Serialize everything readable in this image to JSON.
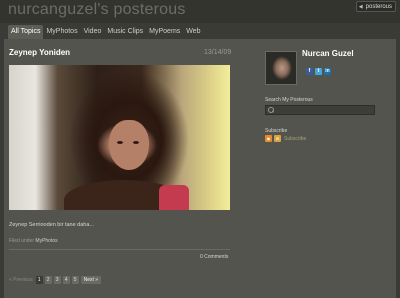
{
  "header": {
    "blog_title": "nurcanguzel's posterous",
    "badge_label": "posterous"
  },
  "nav": {
    "items": [
      {
        "label": "All Topics",
        "active": true
      },
      {
        "label": "MyPhotos"
      },
      {
        "label": "Video"
      },
      {
        "label": "Music Clips"
      },
      {
        "label": "MyPoems"
      },
      {
        "label": "Web"
      }
    ]
  },
  "post": {
    "title": "Zeynep Yoniden",
    "date": "13/14/09",
    "body": "Zeynep Serriooden bir tane daha...",
    "filed_prefix": "Filed under",
    "filed_tag": "MyPhotos",
    "comments": "0 Comments"
  },
  "pagination": {
    "prev": "« Previous",
    "pages": [
      "1",
      "2",
      "3",
      "4",
      "5"
    ],
    "current": "1",
    "next": "Next »"
  },
  "sidebar": {
    "author": "Nurcan Guzel",
    "social_icons": [
      "facebook-icon",
      "twitter-icon",
      "linkedin-icon"
    ],
    "search_label": "Search My Posterous",
    "search_placeholder": "",
    "subscribe_label": "Subscribe",
    "subscribe_link": "Subscribe"
  },
  "colors": {
    "background": "#3a3a36",
    "panel": "#54544f",
    "active_tab": "#5d5d56",
    "rss": "#e58a2c"
  }
}
